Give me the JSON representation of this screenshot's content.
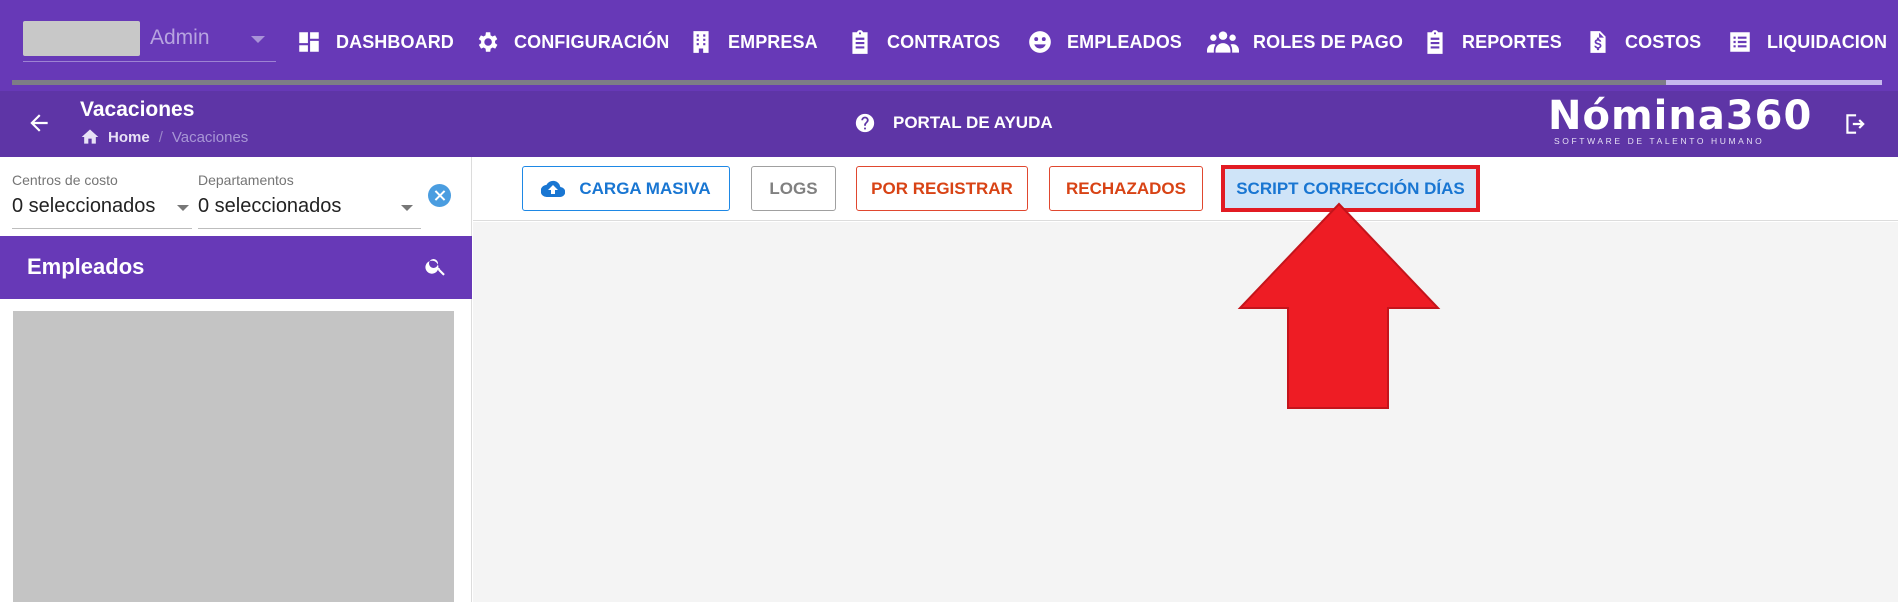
{
  "topnav": {
    "admin_label": "Admin",
    "items": [
      {
        "label": "DASHBOARD",
        "icon": "dashboard-icon"
      },
      {
        "label": "CONFIGURACIÓN",
        "icon": "gear-icon"
      },
      {
        "label": "EMPRESA",
        "icon": "building-icon"
      },
      {
        "label": "CONTRATOS",
        "icon": "clipboard-icon"
      },
      {
        "label": "EMPLEADOS",
        "icon": "face-icon"
      },
      {
        "label": "ROLES DE PAGO",
        "icon": "people-icon"
      },
      {
        "label": "REPORTES",
        "icon": "clipboard-icon"
      },
      {
        "label": "COSTOS",
        "icon": "dollar-file-icon"
      },
      {
        "label": "LIQUIDACIONE",
        "icon": "list-icon"
      }
    ]
  },
  "subheader": {
    "title": "Vacaciones",
    "breadcrumb": {
      "home": "Home",
      "separator": "/",
      "current": "Vacaciones"
    },
    "help_portal": "PORTAL DE AYUDA",
    "logo": {
      "main": "Nómina360",
      "tagline": "SOFTWARE DE TALENTO HUMANO"
    }
  },
  "filters": {
    "cost_centers": {
      "label": "Centros de costo",
      "value": "0 seleccionados"
    },
    "departments": {
      "label": "Departamentos",
      "value": "0 seleccionados"
    }
  },
  "employees": {
    "title": "Empleados"
  },
  "toolbar": {
    "carga_masiva": "CARGA MASIVA",
    "logs": "LOGS",
    "por_registrar": "POR REGISTRAR",
    "rechazados": "RECHAZADOS",
    "script_correccion": "SCRIPT CORRECCIÓN DÍAS"
  },
  "colors": {
    "primary": "#6739b7",
    "subheader": "#5e35a6",
    "accent_blue": "#1976d2",
    "danger": "#d84315",
    "highlight": "#e21b23"
  }
}
